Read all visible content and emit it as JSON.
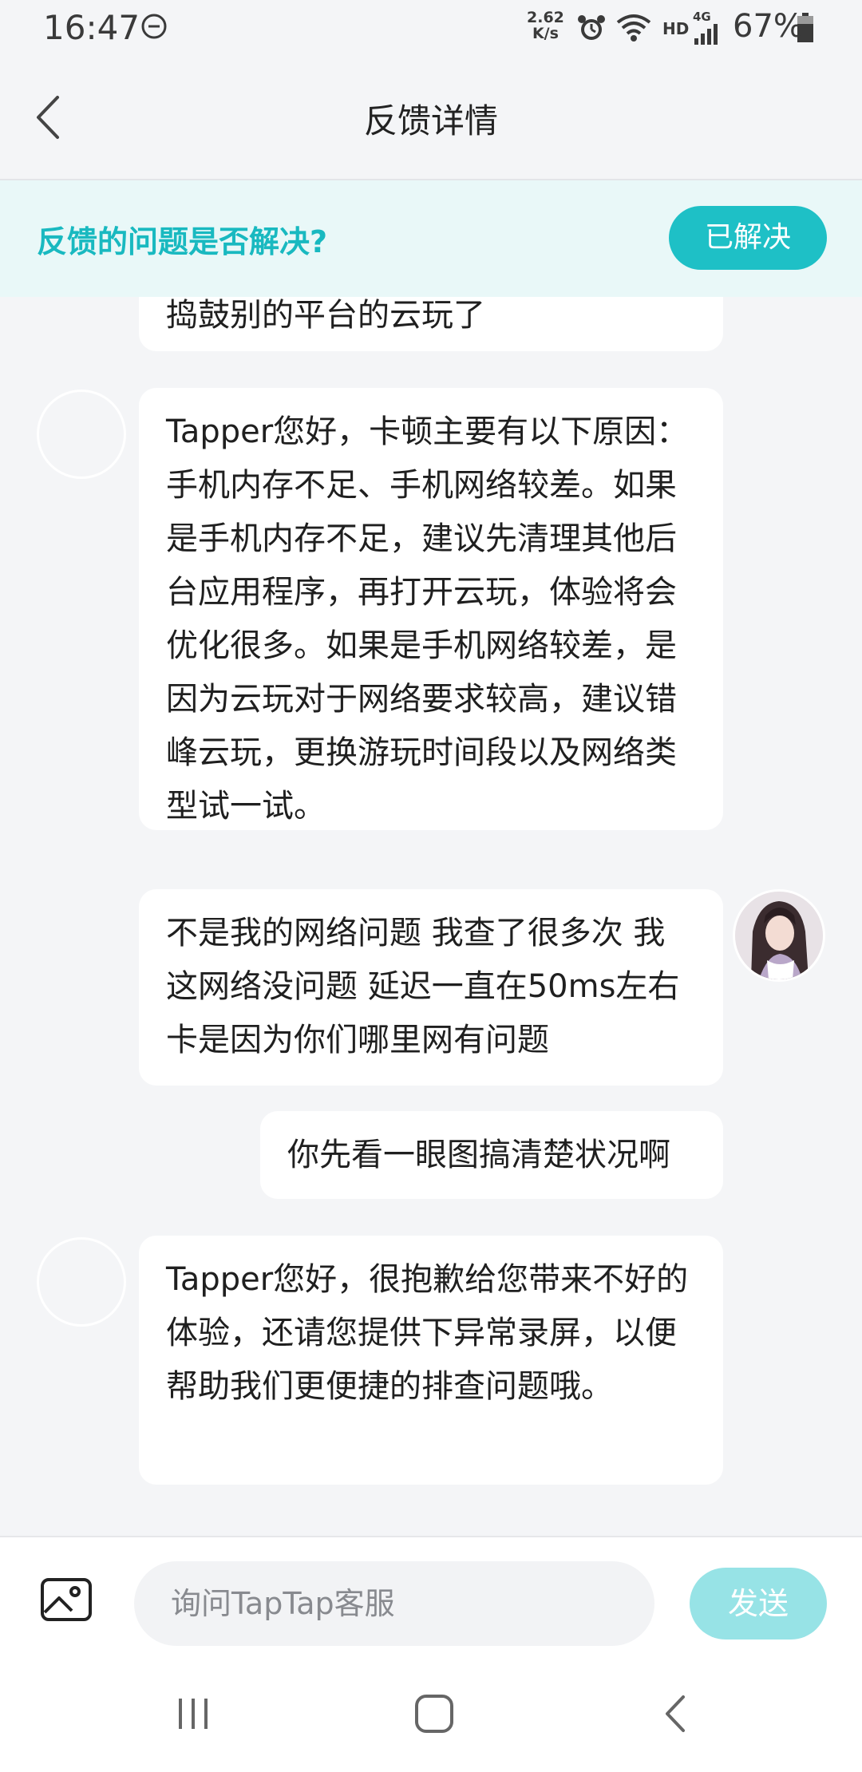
{
  "status_bar": {
    "time": "16:47",
    "net_speed_value": "2.62",
    "net_speed_unit": "K/s",
    "hd_label": "HD",
    "network_label": "4G",
    "battery": "67%"
  },
  "header": {
    "title": "反馈详情"
  },
  "banner": {
    "question": "反馈的问题是否解决?",
    "resolved_label": "已解决"
  },
  "messages": [
    {
      "sender": "agent",
      "text": "捣鼓别的平台的云玩了"
    },
    {
      "sender": "agent",
      "text": "Tapper您好，卡顿主要有以下原因：手机内存不足、手机网络较差。如果是手机内存不足，建议先清理其他后台应用程序，再打开云玩，体验将会优化很多。如果是手机网络较差，是因为云玩对于网络要求较高，建议错峰云玩，更换游玩时间段以及网络类型试一试。"
    },
    {
      "sender": "user",
      "text": "不是我的网络问题 我查了很多次 我这网络没问题 延迟一直在50ms左右 卡是因为你们哪里网有问题"
    },
    {
      "sender": "user",
      "text": "你先看一眼图搞清楚状况啊"
    },
    {
      "sender": "agent",
      "text": "Tapper您好，很抱歉给您带来不好的体验，还请您提供下异常录屏，以便帮助我们更便捷的排查问题哦。"
    }
  ],
  "input": {
    "placeholder": "询问TapTap客服",
    "send_label": "发送"
  },
  "colors": {
    "accent": "#1ec0c6",
    "accent_text": "#19b9c0",
    "send_disabled": "#97e3e6",
    "banner_bg": "#e9f8f8",
    "page_bg": "#f4f5f7"
  },
  "icons": [
    "dnd-icon",
    "alarm-icon",
    "wifi-icon",
    "signal-icon",
    "battery-icon",
    "back-arrow-icon",
    "image-icon",
    "recents-icon",
    "home-icon",
    "nav-back-icon"
  ]
}
